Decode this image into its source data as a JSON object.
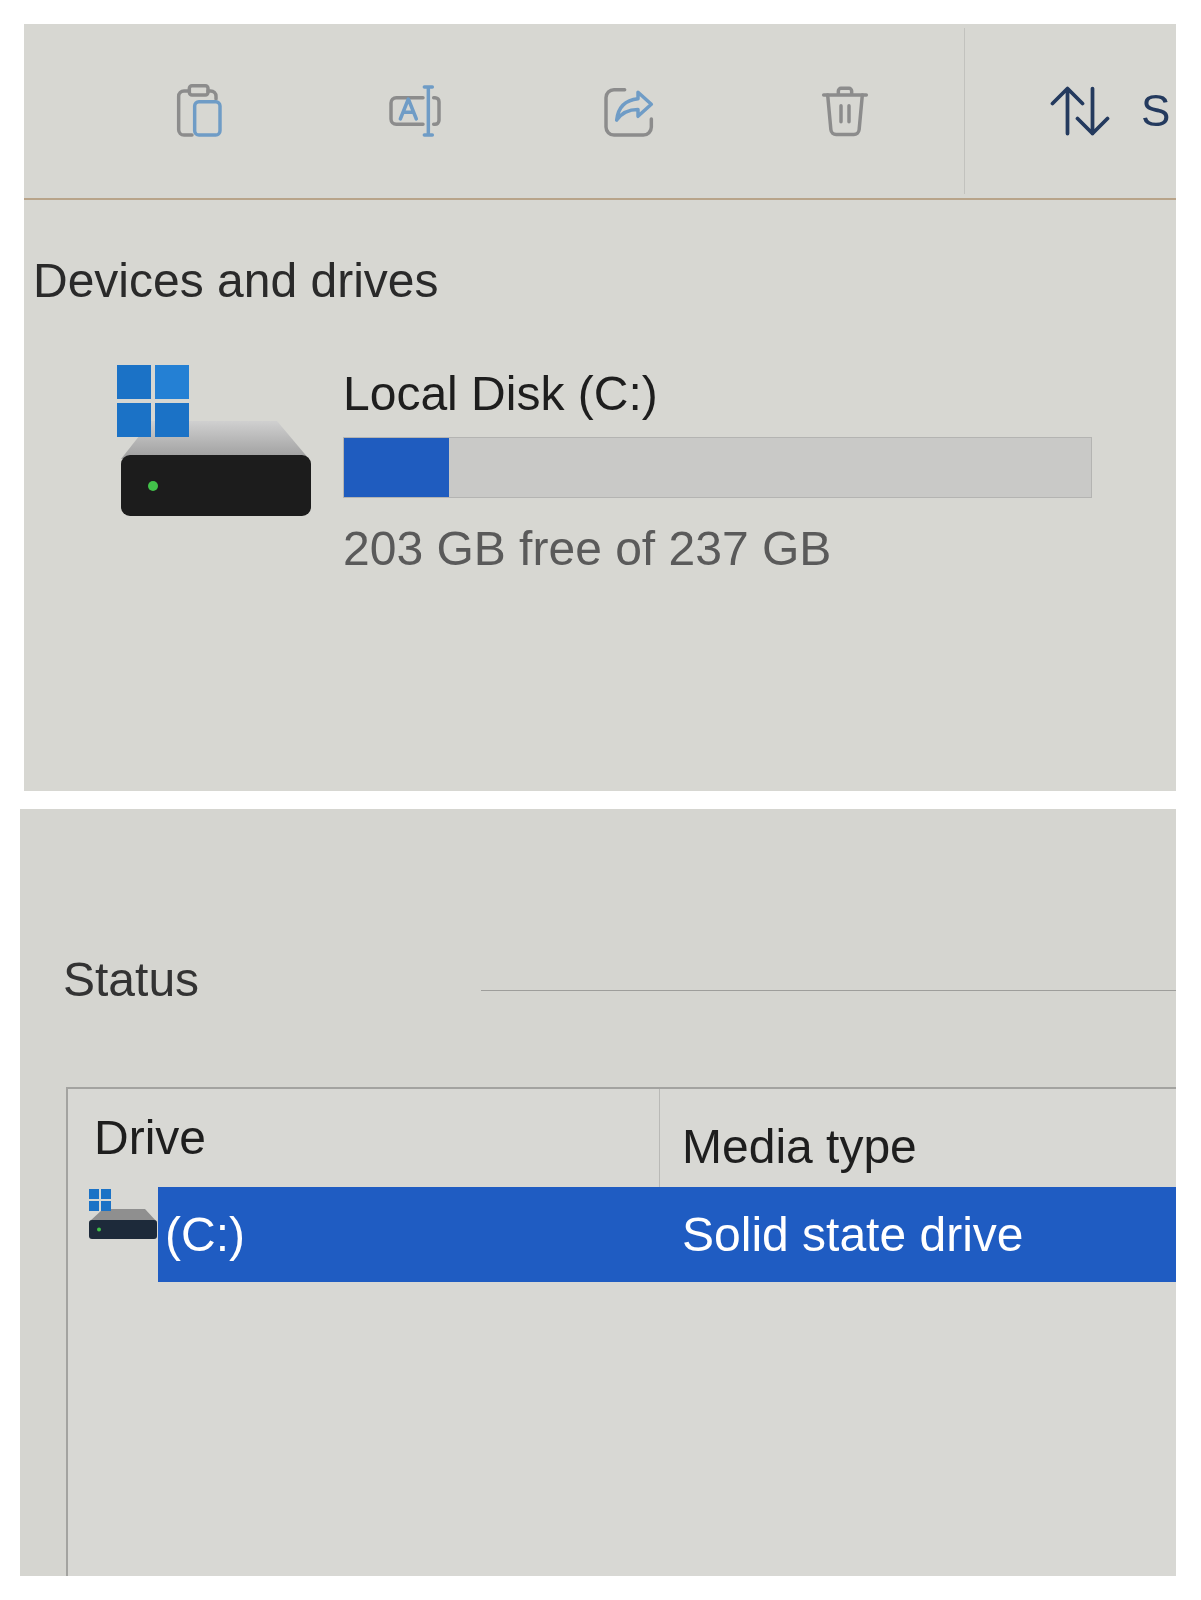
{
  "toolbar": {
    "sort_button": {
      "label": "S"
    }
  },
  "devices_section": {
    "title": "Devices and drives",
    "drives": [
      {
        "name": "Local Disk (C:)",
        "level": 0.14,
        "reading": "203 GB free of 237 GB"
      }
    ]
  },
  "status_section": {
    "title": "Status",
    "table": {
      "columns": [
        "Drive",
        "Media type"
      ],
      "rows": [
        {
          "cells": [
            "(C:)",
            "Solid state drive"
          ],
          "selected": true
        }
      ]
    }
  }
}
